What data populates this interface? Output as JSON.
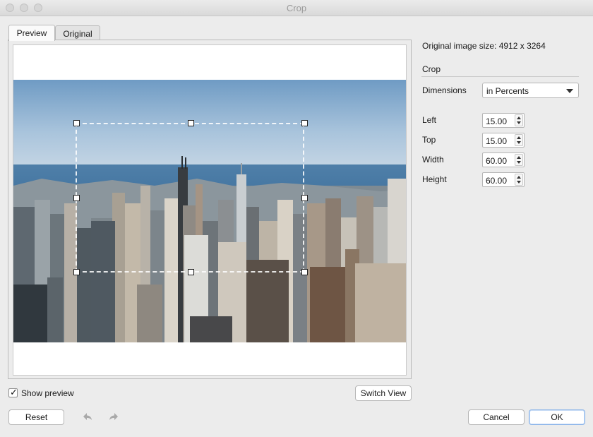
{
  "window": {
    "title": "Crop"
  },
  "tabs": [
    {
      "label": "Preview"
    },
    {
      "label": "Original"
    }
  ],
  "info": {
    "original_size": "Original image size: 4912 x 3264"
  },
  "crop": {
    "section_title": "Crop",
    "dimensions_label": "Dimensions",
    "dimensions_value": "in Percents",
    "fields": [
      {
        "label": "Left",
        "value": "15.00"
      },
      {
        "label": "Top",
        "value": "15.00"
      },
      {
        "label": "Width",
        "value": "60.00"
      },
      {
        "label": "Height",
        "value": "60.00"
      }
    ]
  },
  "bottom": {
    "show_preview_label": "Show preview",
    "show_preview_checked": true,
    "switch_view_label": "Switch View",
    "reset_label": "Reset",
    "cancel_label": "Cancel",
    "ok_label": "OK"
  },
  "icons": {
    "undo": "undo-icon",
    "redo": "redo-icon",
    "spin_up": "chevron-up-icon",
    "spin_down": "chevron-down-icon",
    "dropdown": "chevron-down-icon"
  }
}
